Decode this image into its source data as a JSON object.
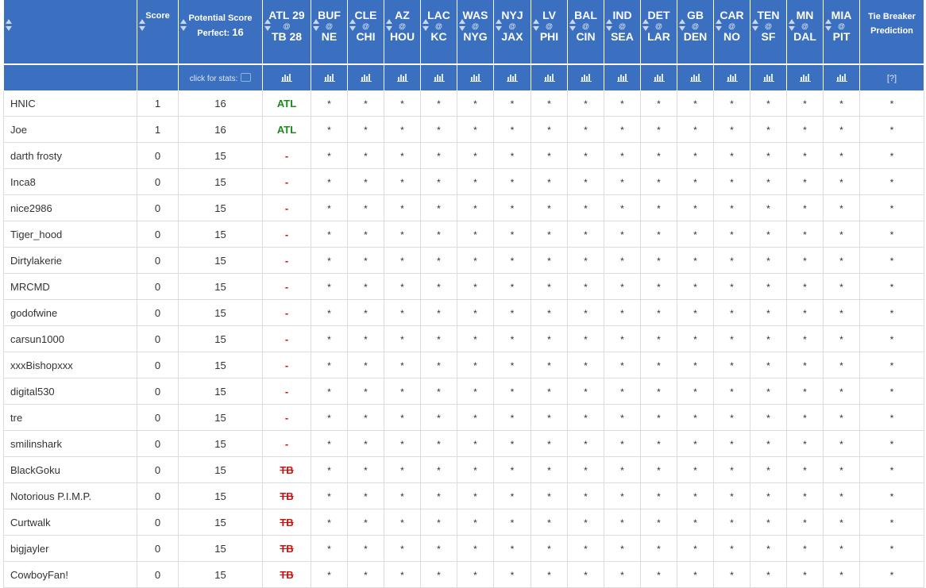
{
  "header": {
    "score_label": "Score",
    "potential_label": "Potential Score",
    "perfect_label": "Perfect:",
    "perfect_value": "16",
    "click_for_stats": "click for stats:",
    "tie_breaker_label": "Tie Breaker Prediction",
    "help_label": "[?]",
    "at_symbol": "@"
  },
  "games": [
    {
      "away": "ATL 29",
      "home": "TB 28"
    },
    {
      "away": "BUF",
      "home": "NE"
    },
    {
      "away": "CLE",
      "home": "CHI"
    },
    {
      "away": "AZ",
      "home": "HOU"
    },
    {
      "away": "LAC",
      "home": "KC"
    },
    {
      "away": "WAS",
      "home": "NYG"
    },
    {
      "away": "NYJ",
      "home": "JAX"
    },
    {
      "away": "LV",
      "home": "PHI"
    },
    {
      "away": "BAL",
      "home": "CIN"
    },
    {
      "away": "IND",
      "home": "SEA"
    },
    {
      "away": "DET",
      "home": "LAR"
    },
    {
      "away": "GB",
      "home": "DEN"
    },
    {
      "away": "CAR",
      "home": "NO"
    },
    {
      "away": "TEN",
      "home": "SF"
    },
    {
      "away": "MN",
      "home": "DAL"
    },
    {
      "away": "MIA",
      "home": "PIT"
    }
  ],
  "pending_mark": "*",
  "rows": [
    {
      "name": "HNIC",
      "score": "1",
      "potential": "16",
      "pick": "ATL",
      "status": "win"
    },
    {
      "name": "Joe",
      "score": "1",
      "potential": "16",
      "pick": "ATL",
      "status": "win"
    },
    {
      "name": "darth frosty",
      "score": "0",
      "potential": "15",
      "pick": "-",
      "status": "none"
    },
    {
      "name": "Inca8",
      "score": "0",
      "potential": "15",
      "pick": "-",
      "status": "none"
    },
    {
      "name": "nice2986",
      "score": "0",
      "potential": "15",
      "pick": "-",
      "status": "none"
    },
    {
      "name": "Tiger_hood",
      "score": "0",
      "potential": "15",
      "pick": "-",
      "status": "none"
    },
    {
      "name": "Dirtylakerie",
      "score": "0",
      "potential": "15",
      "pick": "-",
      "status": "none"
    },
    {
      "name": "MRCMD",
      "score": "0",
      "potential": "15",
      "pick": "-",
      "status": "none"
    },
    {
      "name": "godofwine",
      "score": "0",
      "potential": "15",
      "pick": "-",
      "status": "none"
    },
    {
      "name": "carsun1000",
      "score": "0",
      "potential": "15",
      "pick": "-",
      "status": "none"
    },
    {
      "name": "xxxBishopxxx",
      "score": "0",
      "potential": "15",
      "pick": "-",
      "status": "none"
    },
    {
      "name": "digital530",
      "score": "0",
      "potential": "15",
      "pick": "-",
      "status": "none"
    },
    {
      "name": "tre",
      "score": "0",
      "potential": "15",
      "pick": "-",
      "status": "none"
    },
    {
      "name": "smilinshark",
      "score": "0",
      "potential": "15",
      "pick": "-",
      "status": "none"
    },
    {
      "name": "BlackGoku",
      "score": "0",
      "potential": "15",
      "pick": "TB",
      "status": "loss"
    },
    {
      "name": "Notorious P.I.M.P.",
      "score": "0",
      "potential": "15",
      "pick": "TB",
      "status": "loss"
    },
    {
      "name": "Curtwalk",
      "score": "0",
      "potential": "15",
      "pick": "TB",
      "status": "loss"
    },
    {
      "name": "bigjayler",
      "score": "0",
      "potential": "15",
      "pick": "TB",
      "status": "loss"
    },
    {
      "name": "CowboyFan!",
      "score": "0",
      "potential": "15",
      "pick": "TB",
      "status": "loss"
    }
  ],
  "colors": {
    "header_bg": "#3b6fc0",
    "win": "#1a8a1a",
    "loss": "#d01010"
  }
}
